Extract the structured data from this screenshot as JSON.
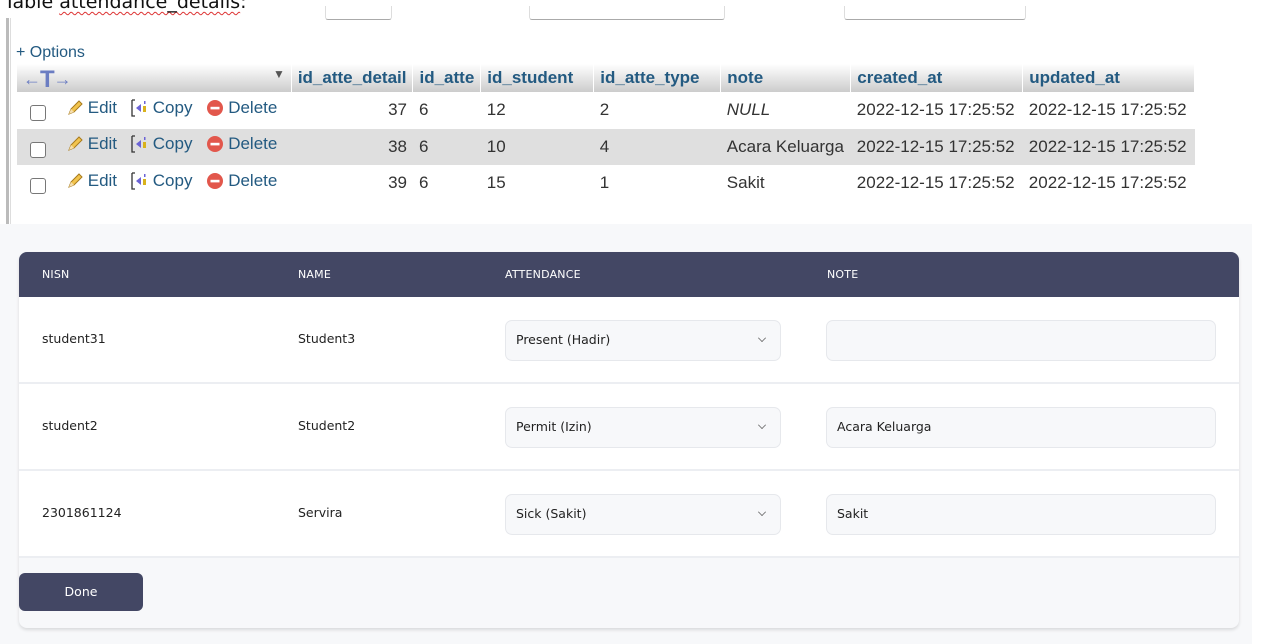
{
  "pma": {
    "title_prefix": "Table ",
    "title_table": "attendance_details",
    "title_suffix": ":",
    "options_label": "+ Options",
    "columns": [
      "id_atte_detail",
      "id_atte",
      "id_student",
      "id_atte_type",
      "note",
      "created_at",
      "updated_at"
    ],
    "actions": {
      "edit": "Edit",
      "copy": "Copy",
      "delete": "Delete"
    },
    "rows": [
      {
        "id_atte_detail": "37",
        "id_atte": "6",
        "id_student": "12",
        "id_atte_type": "2",
        "note": "NULL",
        "created_at": "2022-12-15 17:25:52",
        "updated_at": "2022-12-15 17:25:52"
      },
      {
        "id_atte_detail": "38",
        "id_atte": "6",
        "id_student": "10",
        "id_atte_type": "4",
        "note": "Acara Keluarga",
        "created_at": "2022-12-15 17:25:52",
        "updated_at": "2022-12-15 17:25:52"
      },
      {
        "id_atte_detail": "39",
        "id_atte": "6",
        "id_student": "15",
        "id_atte_type": "1",
        "note": "Sakit",
        "created_at": "2022-12-15 17:25:52",
        "updated_at": "2022-12-15 17:25:52"
      }
    ]
  },
  "attendance": {
    "headers": {
      "nisn": "NISN",
      "name": "NAME",
      "attendance": "ATTENDANCE",
      "note": "NOTE"
    },
    "rows": [
      {
        "nisn": "student31",
        "name": "Student3",
        "attendance": "Present (Hadir)",
        "note": ""
      },
      {
        "nisn": "student2",
        "name": "Student2",
        "attendance": "Permit (Izin)",
        "note": "Acara Keluarga"
      },
      {
        "nisn": "2301861124",
        "name": "Servira",
        "attendance": "Sick (Sakit)",
        "note": "Sakit"
      }
    ],
    "done_label": "Done"
  },
  "colors": {
    "header_bg": "#434764",
    "pma_link": "#235a81"
  }
}
